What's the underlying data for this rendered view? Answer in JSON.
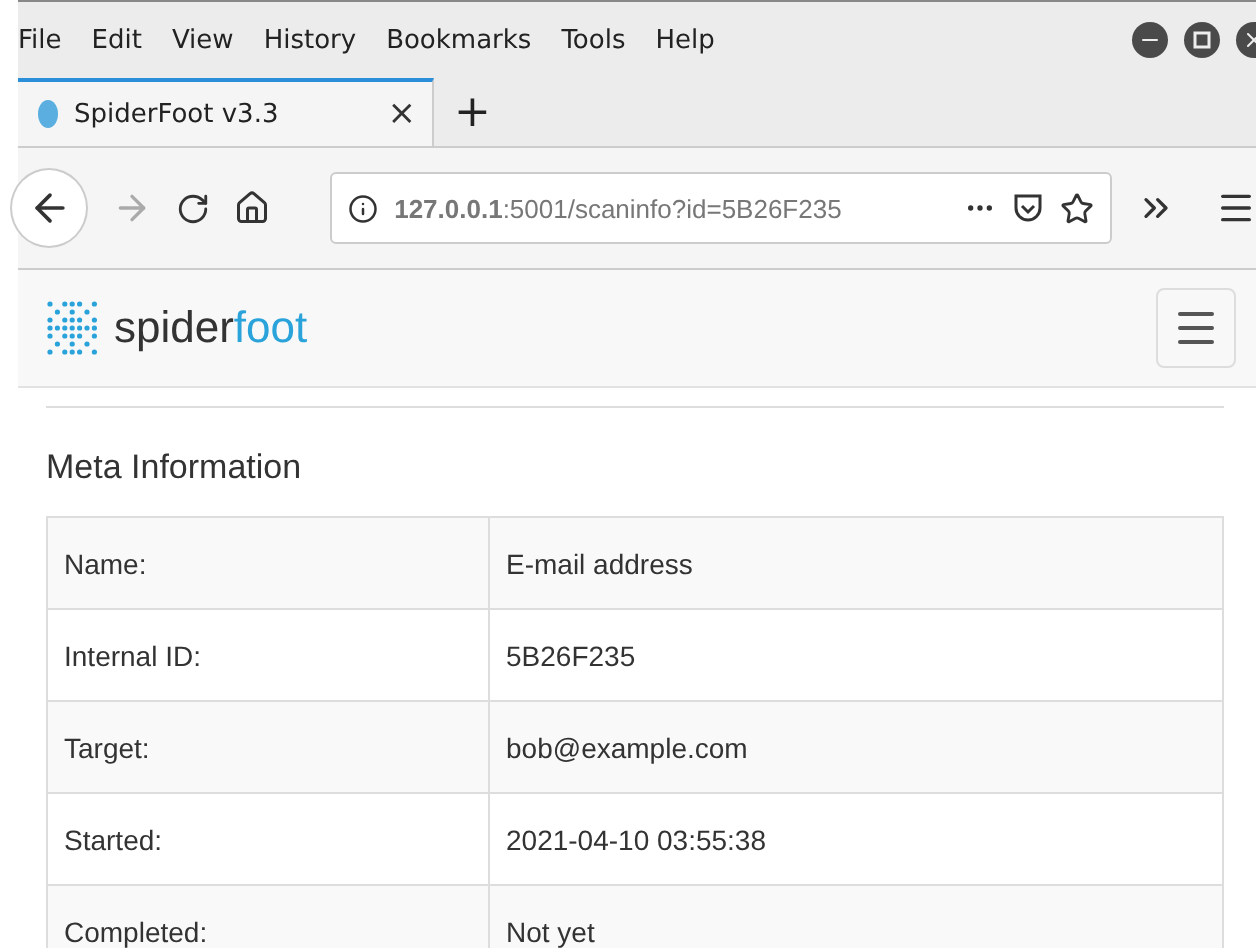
{
  "menu_bar": {
    "items": [
      "File",
      "Edit",
      "View",
      "History",
      "Bookmarks",
      "Tools",
      "Help"
    ]
  },
  "tabs": [
    {
      "label": "SpiderFoot v3.3",
      "selected": true,
      "close": "×"
    }
  ],
  "new_tab": "+",
  "address_bar": {
    "url": "**127.0.0.1**:5001/scaninfo?id=5B26F235",
    "forward_disabled": true
  },
  "navbar": {
    "brand_part_1": "spider",
    "brand_part_2": "foot"
  },
  "section_title": "Meta Information",
  "table": {
    "rows": [
      {
        "label": "Name:",
        "value": "E-mail address"
      },
      {
        "label": "Internal ID:",
        "value": "5B26F235"
      },
      {
        "label": "Target:",
        "value": "bob@example.com"
      },
      {
        "label": "Started:",
        "value": "2021-04-10 03:55:38"
      },
      {
        "label": "Completed:",
        "value": "Not yet"
      }
    ]
  }
}
